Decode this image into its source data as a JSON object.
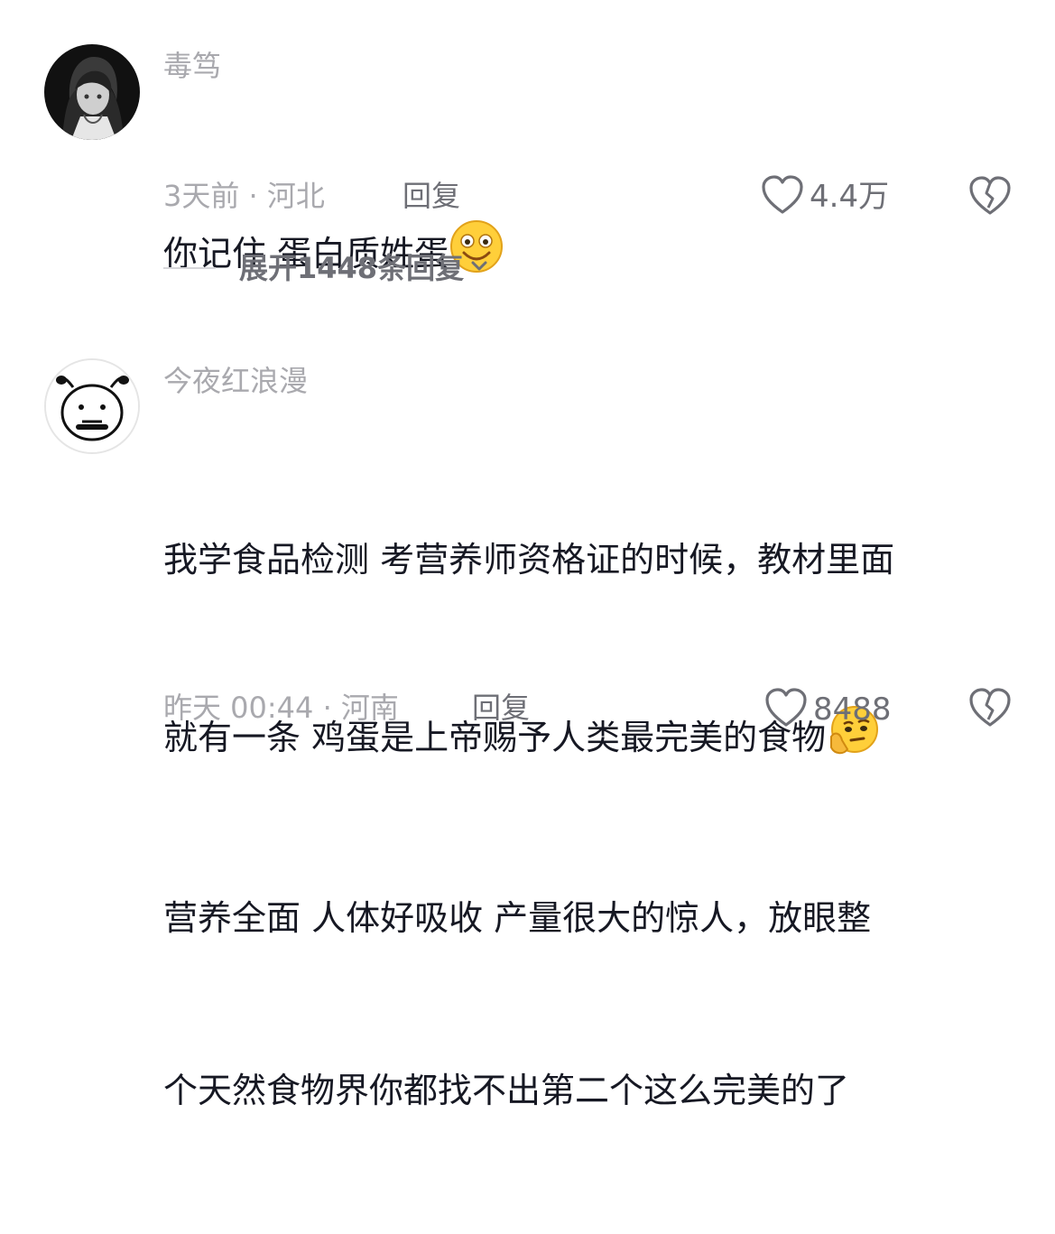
{
  "comments": [
    {
      "username": "毒笃",
      "content_lines": [
        "你记住 蛋白质姓蛋"
      ],
      "emoji": "smiling-face-emoji",
      "meta": "3天前 · 河北",
      "reply_label": "回复",
      "like_count": "4.4万",
      "expand_label": "展开1448条回复"
    },
    {
      "username": "今夜红浪漫",
      "content_lines": [
        "我学食品检测 考营养师资格证的时候，教材里面",
        "就有一条 鸡蛋是上帝赐予人类最完美的食物",
        "营养全面 人体好吸收 产量很大的惊人，放眼整",
        "个天然食物界你都找不出第二个这么完美的了"
      ],
      "emoji": "thinking-face-emoji",
      "meta": "昨天 00:44 · 河南",
      "reply_label": "回复",
      "like_count": "8488"
    }
  ],
  "colors": {
    "username": "#a9a9ae",
    "content": "#161823",
    "meta": "#a9a9ae",
    "action": "#6e6f76"
  }
}
